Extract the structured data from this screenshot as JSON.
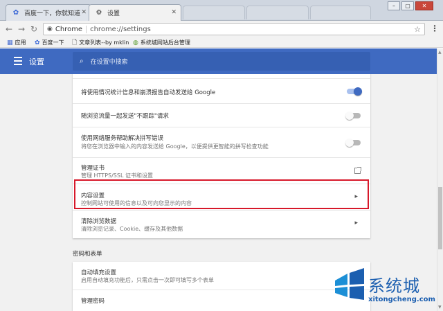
{
  "browser": {
    "tabs": [
      {
        "title": "百度一下，你就知道",
        "icon": "paw-icon"
      },
      {
        "title": "设置",
        "icon": "gear-icon"
      }
    ],
    "address": {
      "chip": "Chrome",
      "url": "chrome://settings"
    },
    "bookmarks": [
      {
        "label": "应用",
        "icon": "apps-grid-icon"
      },
      {
        "label": "百度一下",
        "icon": "paw-icon"
      },
      {
        "label": "文章列表--by mklin",
        "icon": "page-icon"
      },
      {
        "label": "系统城网站后台管理",
        "icon": "globe-icon"
      }
    ]
  },
  "settings": {
    "header_title": "设置",
    "search_placeholder": "在设置中搜索",
    "rows": [
      {
        "title": "将使用情况统计信息和崩溃报告自动发送给 Google",
        "sub": "",
        "control": "toggle",
        "state": "on"
      },
      {
        "title": "随浏览流量一起发送\"不跟踪\"请求",
        "sub": "",
        "control": "toggle",
        "state": "off"
      },
      {
        "title": "使用网络服务帮助解决拼写错误",
        "sub": "将您在浏览器中输入的内容发送给 Google，以便提供更智能的拼写检查功能",
        "control": "toggle",
        "state": "off"
      },
      {
        "title": "管理证书",
        "sub": "管理 HTTPS/SSL 证书和设置",
        "control": "external-link"
      },
      {
        "title": "内容设置",
        "sub": "控制网站可使用的信息以及可向您显示的内容",
        "control": "chevron"
      },
      {
        "title": "清除浏览数据",
        "sub": "清除浏览记录、Cookie、缓存及其他数据",
        "control": "chevron"
      }
    ],
    "section_passwords": "密码和表单",
    "rows2": [
      {
        "title": "自动填充设置",
        "sub": "启用自动填充功能后，只需点击一次即可填写多个表单",
        "control": "none"
      },
      {
        "title": "管理密码",
        "sub": "",
        "control": "none"
      }
    ],
    "highlighted_row": "内容设置"
  },
  "watermark": {
    "brand": "系统城",
    "url": "xitongcheng.com"
  },
  "colors": {
    "accent": "#3f6ac1",
    "highlight": "#d7182a",
    "watermark": "#1c5fb0"
  }
}
